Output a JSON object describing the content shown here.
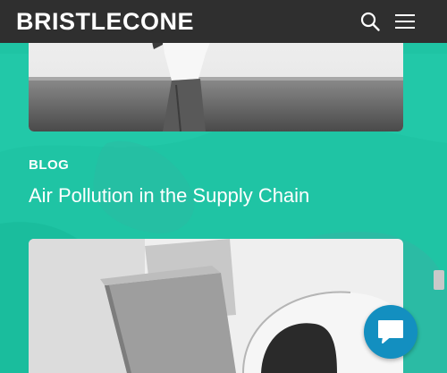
{
  "header": {
    "logo_text": "BRISTLECONE",
    "search_icon": "search-icon",
    "menu_icon": "hamburger-menu-icon"
  },
  "post": {
    "category": "BLOG",
    "title": "Air Pollution in the Supply Chain"
  },
  "chat": {
    "icon": "chat-bubble-icon"
  },
  "colors": {
    "header_bg": "#2f2f2f",
    "page_bg": "#1fc4a4",
    "chat_button": "#138fc0",
    "text": "#ffffff"
  }
}
